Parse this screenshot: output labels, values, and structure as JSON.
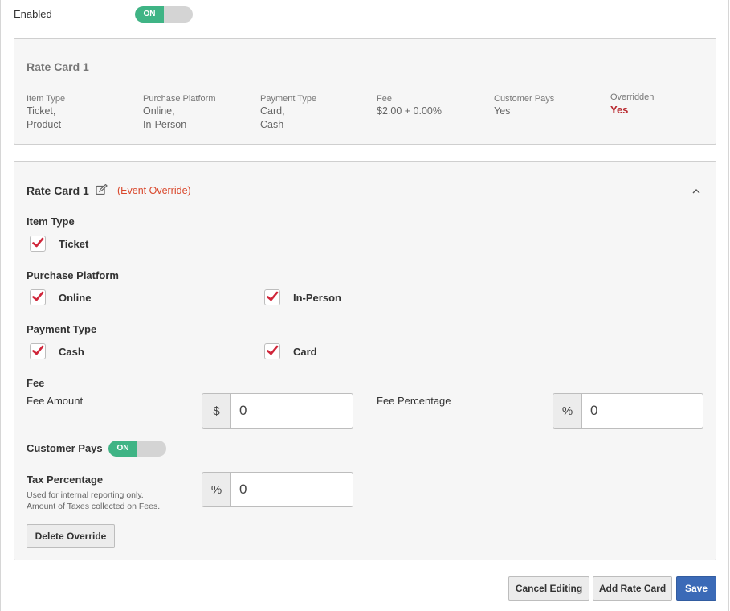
{
  "enabled": {
    "label": "Enabled",
    "toggle": "ON"
  },
  "summary": {
    "title": "Rate Card 1",
    "columns": [
      {
        "header": "Item Type",
        "value": "Ticket,\nProduct"
      },
      {
        "header": "Purchase Platform",
        "value": "Online,\nIn-Person"
      },
      {
        "header": "Payment Type",
        "value": "Card,\nCash"
      },
      {
        "header": "Fee",
        "value": "$2.00 + 0.00%"
      },
      {
        "header": "Customer Pays",
        "value": "Yes"
      },
      {
        "header": "Overridden",
        "value": "Yes"
      }
    ],
    "overridden_color": "#b8282e"
  },
  "edit": {
    "title": "Rate Card 1",
    "override_note": "(Event Override)",
    "override_color": "#d9472b",
    "item_type": {
      "label": "Item Type",
      "options": [
        "Ticket"
      ]
    },
    "purchase_platform": {
      "label": "Purchase Platform",
      "options": [
        "Online",
        "In-Person"
      ]
    },
    "payment_type": {
      "label": "Payment Type",
      "options": [
        "Cash",
        "Card"
      ]
    },
    "fee": {
      "label": "Fee",
      "amount_label": "Fee Amount",
      "amount_prefix": "$",
      "amount_value": "0",
      "percent_label": "Fee Percentage",
      "percent_prefix": "%",
      "percent_value": "0"
    },
    "customer_pays": {
      "label": "Customer Pays",
      "toggle": "ON"
    },
    "tax": {
      "label": "Tax Percentage",
      "help_line1": "Used for internal reporting only.",
      "help_line2": "Amount of Taxes collected on Fees.",
      "prefix": "%",
      "value": "0"
    },
    "delete_label": "Delete Override"
  },
  "footer": {
    "cancel_label": "Cancel Editing",
    "add_label": "Add Rate Card",
    "save_label": "Save"
  },
  "colors": {
    "toggle_on": "#3fb485",
    "check": "#d0263a",
    "primary": "#3b6ab7"
  }
}
